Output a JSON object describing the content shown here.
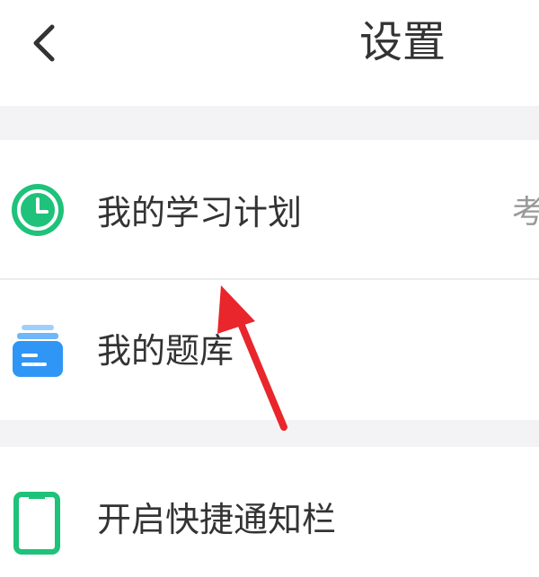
{
  "header": {
    "back_icon": "chevron-left-icon",
    "title": "设置"
  },
  "settings": {
    "items": [
      {
        "label": "我的学习计划",
        "value": "考",
        "icon": "clock-icon",
        "icon_color": "#1fc27a"
      },
      {
        "label": "我的题库",
        "icon": "question-bank-icon",
        "icon_color": "#2f96f5"
      },
      {
        "label": "开启快捷通知栏",
        "icon": "phone-icon",
        "icon_color": "#1fc27a"
      }
    ]
  },
  "annotation": {
    "arrow_icon": "red-arrow-icon",
    "arrow_color": "#e8262b"
  },
  "colors": {
    "section_gap": "#f3f3f5",
    "text": "#333333",
    "divider": "#ececee"
  }
}
